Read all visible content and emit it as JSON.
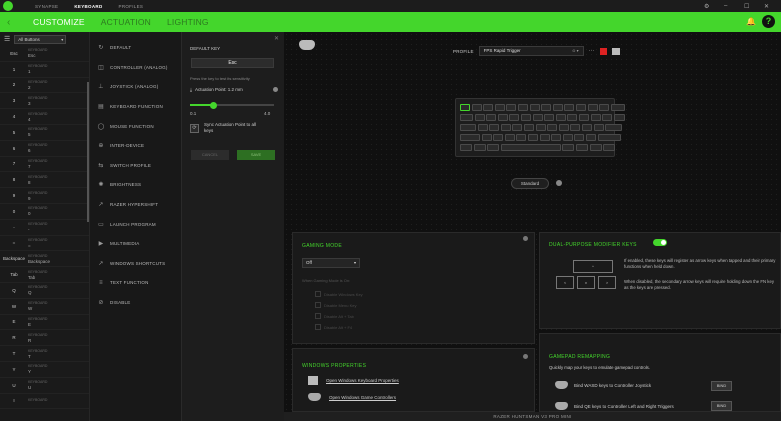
{
  "topbar": {
    "tabs": [
      {
        "label": "SYNAPSE",
        "active": false
      },
      {
        "label": "KEYBOARD",
        "active": true
      },
      {
        "label": "PROFILES",
        "active": false
      }
    ],
    "controls": [
      "⚙",
      "–",
      "☐",
      "✕"
    ]
  },
  "nav": {
    "back": "‹",
    "tabs": [
      {
        "label": "CUSTOMIZE",
        "active": true
      },
      {
        "label": "ACTUATION",
        "active": false
      },
      {
        "label": "LIGHTING",
        "active": false
      }
    ],
    "help": "?"
  },
  "keylist": {
    "filter": "All Buttons",
    "rows": [
      {
        "key": "Esc",
        "bind": "Esc"
      },
      {
        "key": "1",
        "bind": "1"
      },
      {
        "key": "2",
        "bind": "2"
      },
      {
        "key": "3",
        "bind": "3"
      },
      {
        "key": "4",
        "bind": "4"
      },
      {
        "key": "5",
        "bind": "5"
      },
      {
        "key": "6",
        "bind": "6"
      },
      {
        "key": "7",
        "bind": "7"
      },
      {
        "key": "8",
        "bind": "8"
      },
      {
        "key": "9",
        "bind": "9"
      },
      {
        "key": "0",
        "bind": "0"
      },
      {
        "key": "-",
        "bind": "-"
      },
      {
        "key": "=",
        "bind": "="
      },
      {
        "key": "Backspace",
        "bind": "Backspace"
      },
      {
        "key": "Tab",
        "bind": "Tab"
      },
      {
        "key": "Q",
        "bind": "Q"
      },
      {
        "key": "W",
        "bind": "W"
      },
      {
        "key": "E",
        "bind": "E"
      },
      {
        "key": "R",
        "bind": "R"
      },
      {
        "key": "T",
        "bind": "T"
      },
      {
        "key": "Y",
        "bind": "Y"
      },
      {
        "key": "U",
        "bind": "U"
      },
      {
        "key": "I",
        "bind": ""
      }
    ],
    "bind_caption": "KEYBOARD"
  },
  "functions": [
    {
      "icon": "↻",
      "label": "DEFAULT"
    },
    {
      "icon": "◫",
      "label": "CONTROLLER (ANALOG)"
    },
    {
      "icon": "⊥",
      "label": "JOYSTICK (ANALOG)"
    },
    {
      "icon": "▤",
      "label": "KEYBOARD FUNCTION"
    },
    {
      "icon": "◯",
      "label": "MOUSE FUNCTION"
    },
    {
      "icon": "⊕",
      "label": "INTER-DEVICE"
    },
    {
      "icon": "⇆",
      "label": "SWITCH PROFILE"
    },
    {
      "icon": "✺",
      "label": "BRIGHTNESS"
    },
    {
      "icon": "↗",
      "label": "RAZER HYPERSHIFT"
    },
    {
      "icon": "▭",
      "label": "LAUNCH PROGRAM"
    },
    {
      "icon": "▶",
      "label": "MULTIMEDIA"
    },
    {
      "icon": "↗",
      "label": "WINDOWS SHORTCUTS"
    },
    {
      "icon": "≡",
      "label": "TEXT FUNCTION"
    },
    {
      "icon": "⊘",
      "label": "DISABLE"
    }
  ],
  "editor": {
    "title": "DEFAULT KEY",
    "key": "Esc",
    "hint": "Press the key to test its sensitivity",
    "actuation_label": "Actuation Point: 1.2 mm",
    "slider_min": "0.1",
    "slider_max": "4.0",
    "slider_value": 1.2,
    "slider_range": [
      0.1,
      4.0
    ],
    "sync_label": "Sync Actuation Point to all keys",
    "cancel": "CANCEL",
    "save": "SAVE"
  },
  "main": {
    "profile_label": "PROFILE",
    "profile_value": "FPS Rapid Trigger",
    "profile_more": "···",
    "standard_label": "Standard",
    "gaming": {
      "title": "GAMING MODE",
      "value": "Off",
      "when_on": "When Gaming Mode is On:",
      "options": [
        "Disable Windows Key",
        "Disable Menu Key",
        "Disable Alt + Tab",
        "Disable Alt + F4"
      ]
    },
    "dual": {
      "title": "DUAL-PURPOSE MODIFIER KEYS",
      "enabled": true,
      "text1": "If enabled, these keys will register as arrow keys when tapped and their primary functions when held down.",
      "text2": "When disabled, the secondary arrow keys will require holding down the FN key as the keys are pressed."
    },
    "gamepad": {
      "title": "GAMEPAD REMAPPING",
      "desc": "Quickly map your keys to emulate gamepad controls.",
      "row1": "Bind WASD keys to Controller Joystick",
      "row2": "Bind QE keys to Controller Left and Right Triggers",
      "bind": "BIND"
    },
    "winprops": {
      "title": "WINDOWS PROPERTIES",
      "link1": "Open Windows Keyboard Properties",
      "link2": "Open Windows Game Controllers"
    },
    "device": "RAZER HUNTSMAN V3 PRO MINI"
  },
  "colors": {
    "accent": "#44d62c",
    "bg": "#121212"
  }
}
